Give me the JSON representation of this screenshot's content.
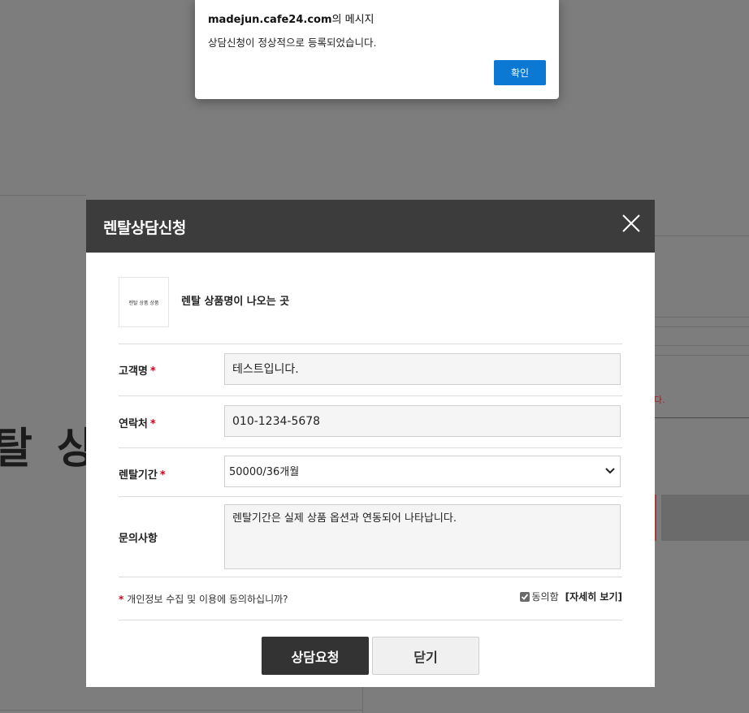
{
  "alert": {
    "domain": "madejun.cafe24.com",
    "title_suffix": "의 메시지",
    "message": "상담신청이 정상적으로 등록되었습니다.",
    "ok_label": "확인"
  },
  "background": {
    "big_text": "탈 상"
  },
  "modal": {
    "title": "렌탈상담신청",
    "product": {
      "thumbnail_text": "렌탈 상품 상품",
      "name": "렌탈 상품명이 나오는 곳"
    },
    "fields": {
      "name": {
        "label": "고객명",
        "required": "*",
        "value": "테스트입니다."
      },
      "phone": {
        "label": "연락처",
        "required": "*",
        "value": "010-1234-5678"
      },
      "period": {
        "label": "렌탈기간",
        "required": "*",
        "value": "50000/36개월"
      },
      "inquiry": {
        "label": "문의사항",
        "value": "렌탈기간은 실제 상품 옵션과 연동되어 나타납니다."
      }
    },
    "privacy": {
      "required": "*",
      "question": "개인정보 수집 및 이용에 동의하십니까?",
      "agree_label": "동의함",
      "detail_link": "[자세히 보기]"
    },
    "buttons": {
      "submit": "상담요청",
      "close": "닫기"
    }
  }
}
